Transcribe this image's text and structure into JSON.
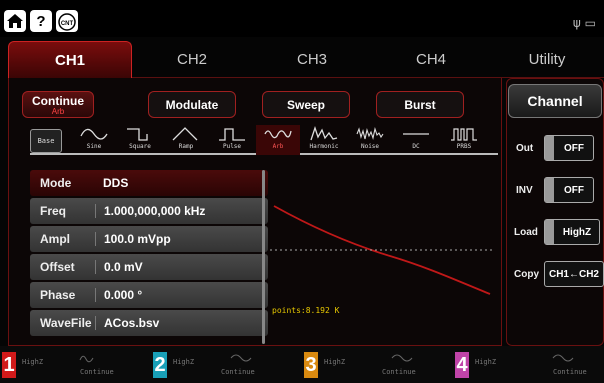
{
  "topbar": {
    "icons": [
      "home-icon",
      "help-icon",
      "counter-icon"
    ],
    "counter_label": "CNT",
    "usb_icon": "usb-icon"
  },
  "tabs": [
    {
      "label": "CH1"
    },
    {
      "label": "CH2"
    },
    {
      "label": "CH3"
    },
    {
      "label": "CH4"
    },
    {
      "label": "Utility"
    }
  ],
  "modes": [
    {
      "label": "Continue",
      "sub": "Arb"
    },
    {
      "label": "Modulate",
      "sub": ""
    },
    {
      "label": "Sweep",
      "sub": ""
    },
    {
      "label": "Burst",
      "sub": ""
    }
  ],
  "waveforms": {
    "base_label": "Base",
    "items": [
      {
        "label": "Sine",
        "icon": "sine-wave-icon"
      },
      {
        "label": "Square",
        "icon": "square-wave-icon"
      },
      {
        "label": "Ramp",
        "icon": "ramp-wave-icon"
      },
      {
        "label": "Pulse",
        "icon": "pulse-wave-icon"
      },
      {
        "label": "Arb",
        "icon": "arb-wave-icon"
      },
      {
        "label": "Harmonic",
        "icon": "harmonic-wave-icon"
      },
      {
        "label": "Noise",
        "icon": "noise-wave-icon"
      },
      {
        "label": "DC",
        "icon": "dc-wave-icon"
      },
      {
        "label": "PRBS",
        "icon": "prbs-wave-icon"
      }
    ],
    "selected": "Arb"
  },
  "params": [
    {
      "label": "Mode",
      "value": "DDS"
    },
    {
      "label": "Freq",
      "value": "1.000,000,000 kHz"
    },
    {
      "label": "Ampl",
      "value": "100.0 mVpp"
    },
    {
      "label": "Offset",
      "value": "0.0 mV"
    },
    {
      "label": "Phase",
      "value": "0.000 °"
    },
    {
      "label": "WaveFile",
      "value": "ACos.bsv"
    }
  ],
  "preview": {
    "points_text": "points:8.192 K"
  },
  "channel_panel": {
    "title": "Channel",
    "out": {
      "label": "Out",
      "value": "OFF"
    },
    "inv": {
      "label": "INV",
      "value": "OFF"
    },
    "load": {
      "label": "Load",
      "value": "HighZ"
    },
    "copy": {
      "label": "Copy",
      "value": "CH1←CH2"
    }
  },
  "status": [
    {
      "num": "1",
      "load": "HighZ",
      "mode": "Continue",
      "color": "#d11a1a"
    },
    {
      "num": "2",
      "load": "HighZ",
      "mode": "Continue",
      "color": "#19a0b8"
    },
    {
      "num": "3",
      "load": "HighZ",
      "mode": "Continue",
      "color": "#d98a10"
    },
    {
      "num": "4",
      "load": "HighZ",
      "mode": "Continue",
      "color": "#c044a8"
    }
  ],
  "colors": {
    "accent": "#b01515",
    "points": "#e8c800"
  }
}
